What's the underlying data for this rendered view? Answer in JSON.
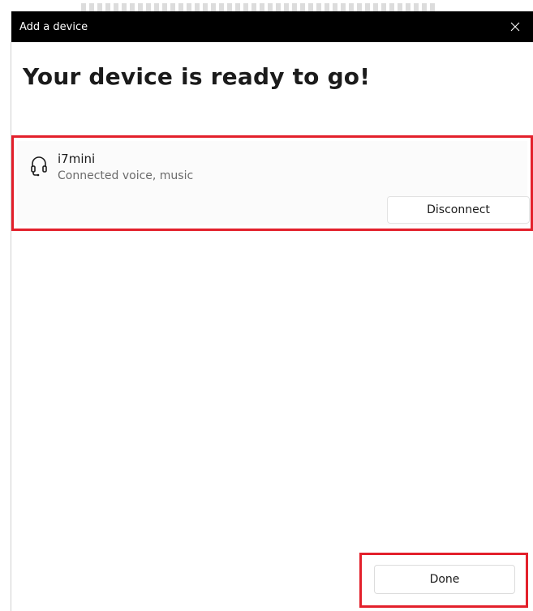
{
  "window": {
    "title": "Add a device",
    "close_icon": "close-icon"
  },
  "main": {
    "heading": "Your device is ready to go!"
  },
  "device": {
    "icon": "headset-icon",
    "name": "i7mini",
    "status": "Connected voice, music",
    "disconnect_label": "Disconnect"
  },
  "footer": {
    "done_label": "Done"
  },
  "colors": {
    "titlebar_bg": "#000000",
    "highlight": "#e3202b",
    "secondary_text": "#6b6b6b"
  }
}
